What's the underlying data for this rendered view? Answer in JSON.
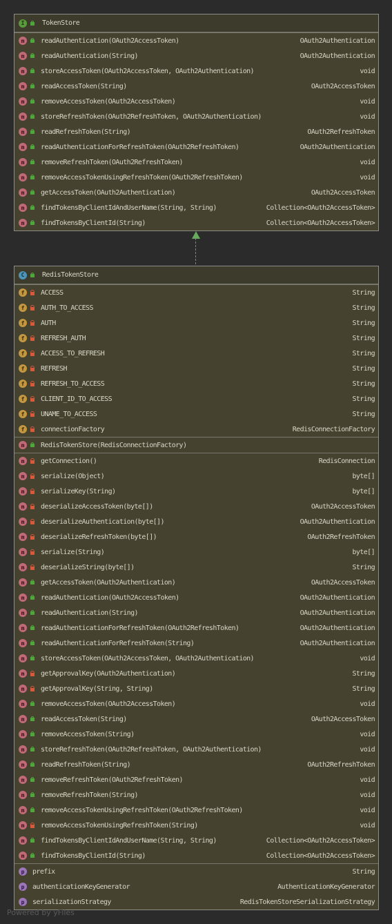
{
  "token_store": {
    "icon": "I",
    "title": "TokenStore",
    "methods": [
      {
        "name": "readAuthentication(OAuth2AccessToken)",
        "type": "OAuth2Authentication"
      },
      {
        "name": "readAuthentication(String)",
        "type": "OAuth2Authentication"
      },
      {
        "name": "storeAccessToken(OAuth2AccessToken, OAuth2Authentication)",
        "type": "void"
      },
      {
        "name": "readAccessToken(String)",
        "type": "OAuth2AccessToken"
      },
      {
        "name": "removeAccessToken(OAuth2AccessToken)",
        "type": "void"
      },
      {
        "name": "storeRefreshToken(OAuth2RefreshToken, OAuth2Authentication)",
        "type": "void"
      },
      {
        "name": "readRefreshToken(String)",
        "type": "OAuth2RefreshToken"
      },
      {
        "name": "readAuthenticationForRefreshToken(OAuth2RefreshToken)",
        "type": "OAuth2Authentication"
      },
      {
        "name": "removeRefreshToken(OAuth2RefreshToken)",
        "type": "void"
      },
      {
        "name": "removeAccessTokenUsingRefreshToken(OAuth2RefreshToken)",
        "type": "void"
      },
      {
        "name": "getAccessToken(OAuth2Authentication)",
        "type": "OAuth2AccessToken"
      },
      {
        "name": "findTokensByClientIdAndUserName(String, String)",
        "type": "Collection<OAuth2AccessToken>"
      },
      {
        "name": "findTokensByClientId(String)",
        "type": "Collection<OAuth2AccessToken>"
      }
    ]
  },
  "redis_token_store": {
    "icon": "C",
    "title": "RedisTokenStore",
    "fields": [
      {
        "name": "ACCESS",
        "type": "String"
      },
      {
        "name": "AUTH_TO_ACCESS",
        "type": "String"
      },
      {
        "name": "AUTH",
        "type": "String"
      },
      {
        "name": "REFRESH_AUTH",
        "type": "String"
      },
      {
        "name": "ACCESS_TO_REFRESH",
        "type": "String"
      },
      {
        "name": "REFRESH",
        "type": "String"
      },
      {
        "name": "REFRESH_TO_ACCESS",
        "type": "String"
      },
      {
        "name": "CLIENT_ID_TO_ACCESS",
        "type": "String"
      },
      {
        "name": "UNAME_TO_ACCESS",
        "type": "String"
      },
      {
        "name": "connectionFactory",
        "type": "RedisConnectionFactory"
      }
    ],
    "constructor": {
      "name": "RedisTokenStore(RedisConnectionFactory)",
      "type": ""
    },
    "methods": [
      {
        "name": "getConnection()",
        "type": "RedisConnection",
        "vis": "priv"
      },
      {
        "name": "serialize(Object)",
        "type": "byte[]",
        "vis": "priv"
      },
      {
        "name": "serializeKey(String)",
        "type": "byte[]",
        "vis": "priv"
      },
      {
        "name": "deserializeAccessToken(byte[])",
        "type": "OAuth2AccessToken",
        "vis": "priv"
      },
      {
        "name": "deserializeAuthentication(byte[])",
        "type": "OAuth2Authentication",
        "vis": "priv"
      },
      {
        "name": "deserializeRefreshToken(byte[])",
        "type": "OAuth2RefreshToken",
        "vis": "priv"
      },
      {
        "name": "serialize(String)",
        "type": "byte[]",
        "vis": "priv"
      },
      {
        "name": "deserializeString(byte[])",
        "type": "String",
        "vis": "priv"
      },
      {
        "name": "getAccessToken(OAuth2Authentication)",
        "type": "OAuth2AccessToken",
        "vis": "pub"
      },
      {
        "name": "readAuthentication(OAuth2AccessToken)",
        "type": "OAuth2Authentication",
        "vis": "pub"
      },
      {
        "name": "readAuthentication(String)",
        "type": "OAuth2Authentication",
        "vis": "pub"
      },
      {
        "name": "readAuthenticationForRefreshToken(OAuth2RefreshToken)",
        "type": "OAuth2Authentication",
        "vis": "pub"
      },
      {
        "name": "readAuthenticationForRefreshToken(String)",
        "type": "OAuth2Authentication",
        "vis": "pub"
      },
      {
        "name": "storeAccessToken(OAuth2AccessToken, OAuth2Authentication)",
        "type": "void",
        "vis": "pub"
      },
      {
        "name": "getApprovalKey(OAuth2Authentication)",
        "type": "String",
        "vis": "priv"
      },
      {
        "name": "getApprovalKey(String, String)",
        "type": "String",
        "vis": "priv"
      },
      {
        "name": "removeAccessToken(OAuth2AccessToken)",
        "type": "void",
        "vis": "pub"
      },
      {
        "name": "readAccessToken(String)",
        "type": "OAuth2AccessToken",
        "vis": "pub"
      },
      {
        "name": "removeAccessToken(String)",
        "type": "void",
        "vis": "pub"
      },
      {
        "name": "storeRefreshToken(OAuth2RefreshToken, OAuth2Authentication)",
        "type": "void",
        "vis": "pub"
      },
      {
        "name": "readRefreshToken(String)",
        "type": "OAuth2RefreshToken",
        "vis": "pub"
      },
      {
        "name": "removeRefreshToken(OAuth2RefreshToken)",
        "type": "void",
        "vis": "pub"
      },
      {
        "name": "removeRefreshToken(String)",
        "type": "void",
        "vis": "pub"
      },
      {
        "name": "removeAccessTokenUsingRefreshToken(OAuth2RefreshToken)",
        "type": "void",
        "vis": "pub"
      },
      {
        "name": "removeAccessTokenUsingRefreshToken(String)",
        "type": "void",
        "vis": "priv"
      },
      {
        "name": "findTokensByClientIdAndUserName(String, String)",
        "type": "Collection<OAuth2AccessToken>",
        "vis": "pub"
      },
      {
        "name": "findTokensByClientId(String)",
        "type": "Collection<OAuth2AccessToken>",
        "vis": "pub"
      }
    ],
    "properties": [
      {
        "name": "prefix",
        "type": "String"
      },
      {
        "name": "authenticationKeyGenerator",
        "type": "AuthenticationKeyGenerator"
      },
      {
        "name": "serializationStrategy",
        "type": "RedisTokenStoreSerializationStrategy"
      }
    ]
  },
  "footer": "Powered by yFiles"
}
